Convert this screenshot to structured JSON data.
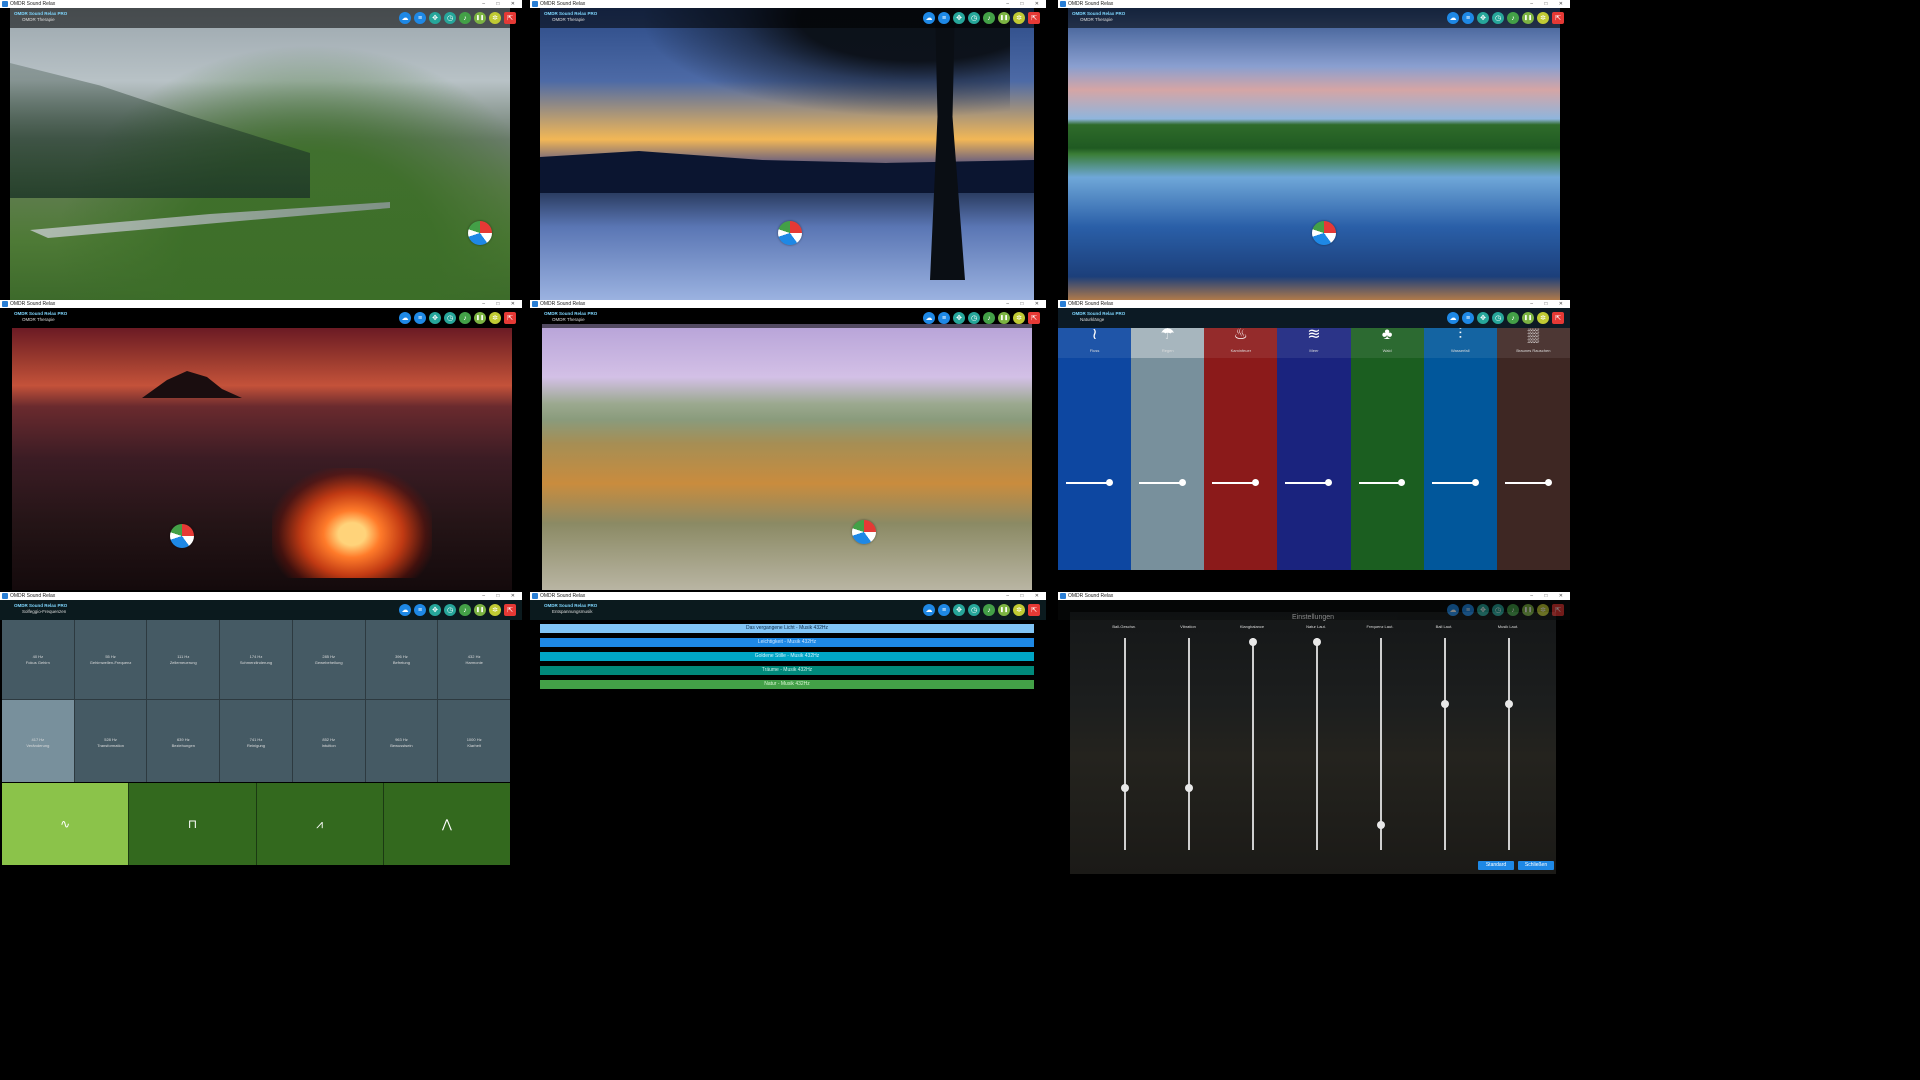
{
  "app": {
    "window_title": "OMDR Sound Relax",
    "header_app_name": "OMDR Sound Relax PRO",
    "window_controls": "– □ ✕"
  },
  "toolbar_icons": [
    {
      "name": "cloud-icon",
      "glyph": "☁",
      "color": "#1e88e5"
    },
    {
      "name": "menu-icon",
      "glyph": "≡",
      "color": "#1e88e5"
    },
    {
      "name": "move-icon",
      "glyph": "✥",
      "color": "#26a69a"
    },
    {
      "name": "timer-icon",
      "glyph": "◷",
      "color": "#26a69a"
    },
    {
      "name": "music-icon",
      "glyph": "♪",
      "color": "#43a047"
    },
    {
      "name": "pause-icon",
      "glyph": "❚❚",
      "color": "#7cb342"
    },
    {
      "name": "settings-icon",
      "glyph": "✲",
      "color": "#c0ca33"
    },
    {
      "name": "exit-icon",
      "glyph": "⇱",
      "color": "#e53935"
    }
  ],
  "windows": {
    "w1": {
      "subtitle": "OMDR Therapie"
    },
    "w2": {
      "subtitle": "OMDR Therapie"
    },
    "w3": {
      "subtitle": "OMDR Therapie"
    },
    "w4": {
      "subtitle": "OMDR Therapie"
    },
    "w5": {
      "subtitle": "OMDR Therapie"
    },
    "w6": {
      "subtitle": "Naturklänge",
      "channels": [
        {
          "label": "Fluss",
          "icon": "river-icon",
          "glyph": "≀",
          "color": "#0d47a1",
          "level": 0.85
        },
        {
          "label": "Regen",
          "icon": "rain-icon",
          "glyph": "☂",
          "color": "#78909c",
          "level": 0.85
        },
        {
          "label": "Kaminfeuer",
          "icon": "fire-icon",
          "glyph": "♨",
          "color": "#8b1a1a",
          "level": 0.85
        },
        {
          "label": "Meer",
          "icon": "waves-icon",
          "glyph": "≋",
          "color": "#1a237e",
          "level": 0.85
        },
        {
          "label": "Wald",
          "icon": "tree-icon",
          "glyph": "♣",
          "color": "#1b5e20",
          "level": 0.85
        },
        {
          "label": "Wasserfall",
          "icon": "waterfall-icon",
          "glyph": "⫶",
          "color": "#01579b",
          "level": 0.85
        },
        {
          "label": "Braunes Rauschen",
          "icon": "noise-icon",
          "glyph": "▒",
          "color": "#3e2723",
          "level": 0.85
        }
      ]
    },
    "w7": {
      "subtitle": "Solfeggio-Frequenzen",
      "freqs": [
        {
          "hz": "40 Hz",
          "name": "Fokus Gehirn"
        },
        {
          "hz": "55 Hz",
          "name": "Gehirnwellen-Frequenz"
        },
        {
          "hz": "111 Hz",
          "name": "Zellerneuerung"
        },
        {
          "hz": "174 Hz",
          "name": "Schmerzlinderung"
        },
        {
          "hz": "285 Hz",
          "name": "Gewebeheilung"
        },
        {
          "hz": "396 Hz",
          "name": "Befreiung"
        },
        {
          "hz": "432 Hz",
          "name": "Harmonie"
        },
        {
          "hz": "417 Hz",
          "name": "Veränderung"
        },
        {
          "hz": "528 Hz",
          "name": "Transformation"
        },
        {
          "hz": "639 Hz",
          "name": "Beziehungen"
        },
        {
          "hz": "741 Hz",
          "name": "Reinigung"
        },
        {
          "hz": "852 Hz",
          "name": "Intuition"
        },
        {
          "hz": "963 Hz",
          "name": "Bewusstsein"
        },
        {
          "hz": "1000 Hz",
          "name": "Klarheit"
        }
      ],
      "waves": [
        {
          "glyph": "∿",
          "name": "sine-wave-icon",
          "color": "#8bc34a"
        },
        {
          "glyph": "⊓",
          "name": "square-wave-icon",
          "color": "#33691e"
        },
        {
          "glyph": "⩘",
          "name": "sawtooth-wave-icon",
          "color": "#33691e"
        },
        {
          "glyph": "⋀",
          "name": "triangle-wave-icon",
          "color": "#33691e"
        }
      ]
    },
    "w8": {
      "subtitle": "Entspannungsmusik",
      "tracks": [
        {
          "label": "Das vergangene Licht - Musik 432Hz",
          "color": "#81c4f5",
          "text_color": "#0a2a4a"
        },
        {
          "label": "Leichtigkeit - Musik 432Hz",
          "color": "#1e88e5",
          "text_color": "#cfe6ff"
        },
        {
          "label": "Goldene Stille - Musik 432Hz",
          "color": "#00a5c5",
          "text_color": "#cff3ff"
        },
        {
          "label": "Träume - Musik 432Hz",
          "color": "#00897b",
          "text_color": "#c8f0e8"
        },
        {
          "label": "Natur - Musik 432Hz",
          "color": "#43a047",
          "text_color": "#d6f5d0"
        }
      ]
    },
    "w9": {
      "dialog_title": "Einstellungen",
      "sliders": [
        {
          "label": "Ball-Geschw.",
          "level": 0.3
        },
        {
          "label": "Vibration",
          "level": 0.3
        },
        {
          "label": "Klangbalance",
          "level": 1.0
        },
        {
          "label": "Natur Laut.",
          "level": 1.0
        },
        {
          "label": "Frequenz Laut.",
          "level": 0.12
        },
        {
          "label": "Ball Laut.",
          "level": 0.7
        },
        {
          "label": "Musik Laut.",
          "level": 0.7
        }
      ],
      "btn_standard": "Standard",
      "btn_close": "Schließen"
    }
  }
}
